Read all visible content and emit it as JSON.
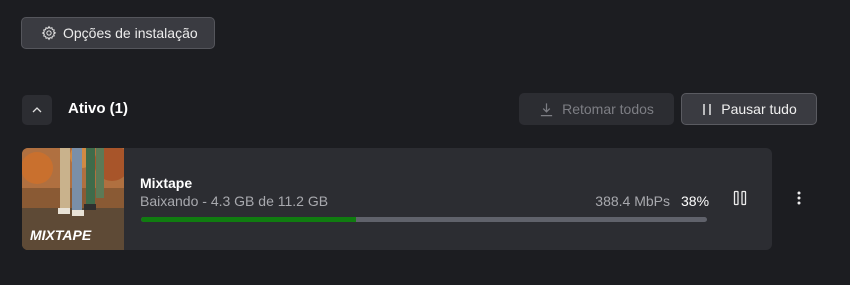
{
  "toolbar": {
    "install_options_label": "Opções de instalação",
    "install_options_icon": "gear-icon"
  },
  "section": {
    "title": "Ativo (1)",
    "collapse_icon": "chevron-up-icon",
    "resume_all_label": "Retomar todos",
    "resume_all_icon": "download-icon",
    "pause_all_label": "Pausar tudo",
    "pause_all_icon": "pause-icon"
  },
  "download": {
    "title": "Mixtape",
    "thumbnail_text": "MIXTAPE",
    "status": "Baixando - 4.3 GB de 11.2 GB",
    "speed": "388.4 MbPs",
    "percent_label": "38%",
    "progress_fraction": 0.38,
    "pause_icon": "pause-icon",
    "more_icon": "more-vertical-icon"
  },
  "colors": {
    "background": "#1c1d21",
    "card": "#2c2d32",
    "progress_fill": "#107c10",
    "progress_track": "#60626b"
  }
}
